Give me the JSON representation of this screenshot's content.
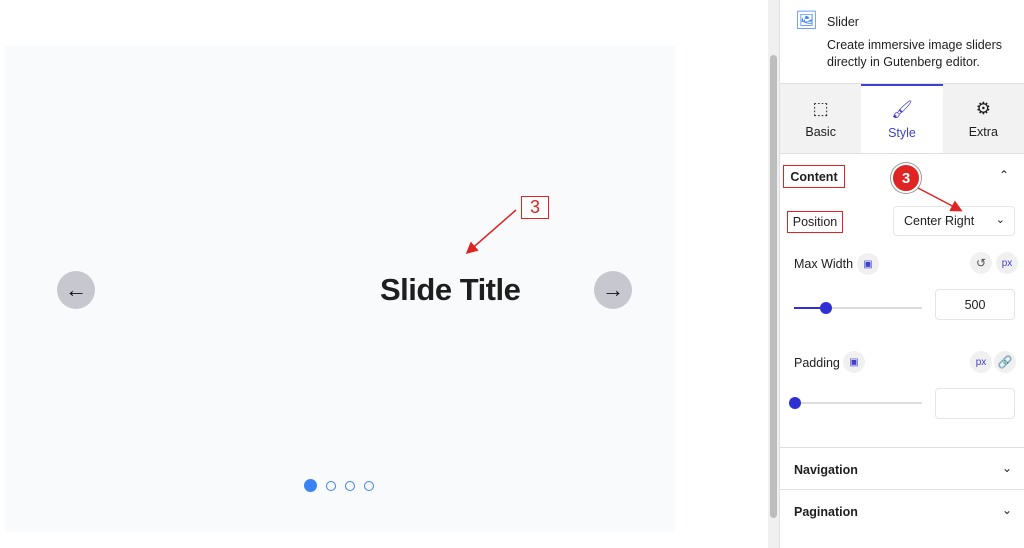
{
  "canvas": {
    "slide_title": "Slide Title",
    "prev_icon": "arrow-left-icon",
    "next_icon": "arrow-right-icon",
    "pagination": {
      "count": 4,
      "active": 1
    },
    "annotation": "3"
  },
  "sidebar": {
    "block": {
      "name": "Slider",
      "description": "Create immersive image sliders directly in Gutenberg editor.",
      "icon": "slider-image-icon"
    },
    "tabs": [
      {
        "label": "Basic",
        "icon": "cursor-select-icon"
      },
      {
        "label": "Style",
        "icon": "paintbrush-icon",
        "active": true
      },
      {
        "label": "Extra",
        "icon": "gear-icon"
      }
    ],
    "content": {
      "title": "Content",
      "position_label": "Position",
      "position_value": "Center Right",
      "max_width_label": "Max Width",
      "max_width_value": "500",
      "max_width_unit": "px",
      "max_width_slider_percent": 25,
      "padding_label": "Padding",
      "padding_value": "",
      "padding_unit": "px",
      "padding_slider_percent": 0
    },
    "annotation": "3",
    "panels": [
      {
        "label": "Navigation"
      },
      {
        "label": "Pagination"
      }
    ]
  },
  "colors": {
    "accent": "#3f3fd1",
    "annotation": "#e02424",
    "dot": "#3b82f6"
  }
}
